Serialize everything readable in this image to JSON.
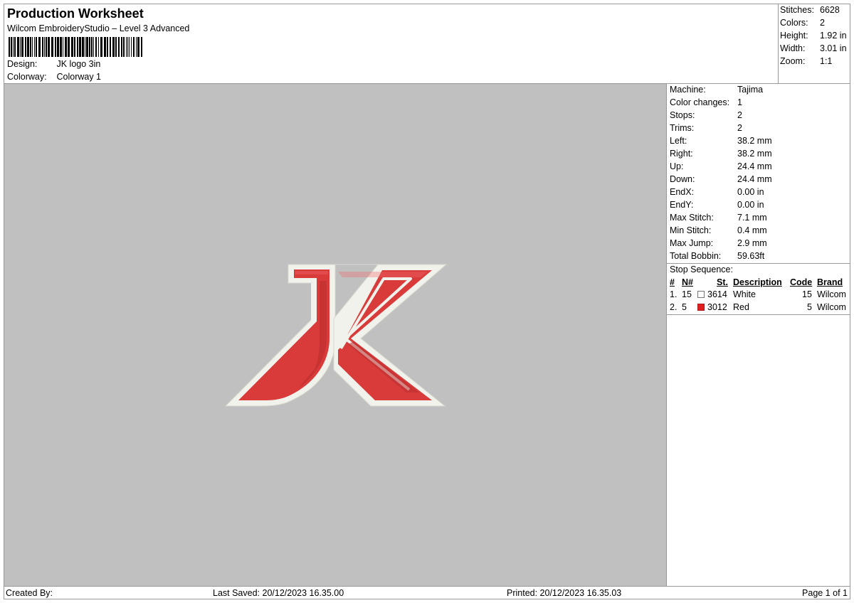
{
  "header": {
    "title": "Production Worksheet",
    "software": "Wilcom EmbroideryStudio – Level 3 Advanced",
    "design_label": "Design:",
    "design_value": "JK logo 3in",
    "colorway_label": "Colorway:",
    "colorway_value": "Colorway 1"
  },
  "summary": {
    "items": [
      {
        "label": "Stitches:",
        "value": "6628"
      },
      {
        "label": "Colors:",
        "value": "2"
      },
      {
        "label": "Height:",
        "value": "1.92 in"
      },
      {
        "label": "Width:",
        "value": "3.01 in"
      },
      {
        "label": "Zoom:",
        "value": "1:1"
      }
    ]
  },
  "machine_info": {
    "items": [
      {
        "label": "Machine:",
        "value": "Tajima"
      },
      {
        "label": "Color changes:",
        "value": "1"
      },
      {
        "label": "Stops:",
        "value": "2"
      },
      {
        "label": "Trims:",
        "value": "2"
      },
      {
        "label": "Left:",
        "value": "38.2 mm"
      },
      {
        "label": "Right:",
        "value": "38.2 mm"
      },
      {
        "label": "Up:",
        "value": "24.4 mm"
      },
      {
        "label": "Down:",
        "value": "24.4 mm"
      },
      {
        "label": "EndX:",
        "value": "0.00 in"
      },
      {
        "label": "EndY:",
        "value": "0.00 in"
      },
      {
        "label": "Max Stitch:",
        "value": "7.1 mm"
      },
      {
        "label": "Min Stitch:",
        "value": "0.4 mm"
      },
      {
        "label": "Max Jump:",
        "value": "2.9 mm"
      },
      {
        "label": "Total Bobbin:",
        "value": "59.63ft"
      }
    ]
  },
  "stop_sequence": {
    "title": "Stop Sequence:",
    "headers": {
      "num": "#",
      "n": "N#",
      "st": "St.",
      "description": "Description",
      "code": "Code",
      "brand": "Brand"
    },
    "rows": [
      {
        "num": "1.",
        "n": "15",
        "color": "#ffffff",
        "st": "3614",
        "description": "White",
        "code": "15",
        "brand": "Wilcom"
      },
      {
        "num": "2.",
        "n": "5",
        "color": "#e02020",
        "st": "3012",
        "description": "Red",
        "code": "5",
        "brand": "Wilcom"
      }
    ]
  },
  "footer": {
    "created_by": "Created By:",
    "last_saved": "Last Saved: 20/12/2023 16.35.00",
    "printed": "Printed: 20/12/2023 16.35.03",
    "page": "Page 1 of 1"
  },
  "colors": {
    "preview_background": "#c0c0c0",
    "thread_red": "#d93b3b",
    "thread_white": "#f2f2ec"
  }
}
